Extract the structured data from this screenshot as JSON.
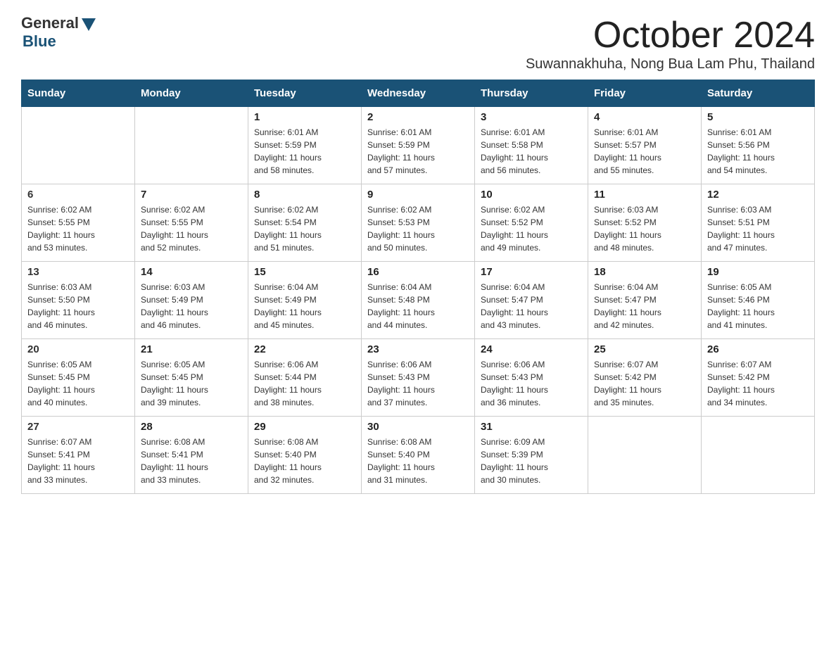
{
  "logo": {
    "general": "General",
    "blue": "Blue"
  },
  "title": "October 2024",
  "location": "Suwannakhuha, Nong Bua Lam Phu, Thailand",
  "days_of_week": [
    "Sunday",
    "Monday",
    "Tuesday",
    "Wednesday",
    "Thursday",
    "Friday",
    "Saturday"
  ],
  "weeks": [
    [
      {
        "day": "",
        "info": ""
      },
      {
        "day": "",
        "info": ""
      },
      {
        "day": "1",
        "info": "Sunrise: 6:01 AM\nSunset: 5:59 PM\nDaylight: 11 hours\nand 58 minutes."
      },
      {
        "day": "2",
        "info": "Sunrise: 6:01 AM\nSunset: 5:59 PM\nDaylight: 11 hours\nand 57 minutes."
      },
      {
        "day": "3",
        "info": "Sunrise: 6:01 AM\nSunset: 5:58 PM\nDaylight: 11 hours\nand 56 minutes."
      },
      {
        "day": "4",
        "info": "Sunrise: 6:01 AM\nSunset: 5:57 PM\nDaylight: 11 hours\nand 55 minutes."
      },
      {
        "day": "5",
        "info": "Sunrise: 6:01 AM\nSunset: 5:56 PM\nDaylight: 11 hours\nand 54 minutes."
      }
    ],
    [
      {
        "day": "6",
        "info": "Sunrise: 6:02 AM\nSunset: 5:55 PM\nDaylight: 11 hours\nand 53 minutes."
      },
      {
        "day": "7",
        "info": "Sunrise: 6:02 AM\nSunset: 5:55 PM\nDaylight: 11 hours\nand 52 minutes."
      },
      {
        "day": "8",
        "info": "Sunrise: 6:02 AM\nSunset: 5:54 PM\nDaylight: 11 hours\nand 51 minutes."
      },
      {
        "day": "9",
        "info": "Sunrise: 6:02 AM\nSunset: 5:53 PM\nDaylight: 11 hours\nand 50 minutes."
      },
      {
        "day": "10",
        "info": "Sunrise: 6:02 AM\nSunset: 5:52 PM\nDaylight: 11 hours\nand 49 minutes."
      },
      {
        "day": "11",
        "info": "Sunrise: 6:03 AM\nSunset: 5:52 PM\nDaylight: 11 hours\nand 48 minutes."
      },
      {
        "day": "12",
        "info": "Sunrise: 6:03 AM\nSunset: 5:51 PM\nDaylight: 11 hours\nand 47 minutes."
      }
    ],
    [
      {
        "day": "13",
        "info": "Sunrise: 6:03 AM\nSunset: 5:50 PM\nDaylight: 11 hours\nand 46 minutes."
      },
      {
        "day": "14",
        "info": "Sunrise: 6:03 AM\nSunset: 5:49 PM\nDaylight: 11 hours\nand 46 minutes."
      },
      {
        "day": "15",
        "info": "Sunrise: 6:04 AM\nSunset: 5:49 PM\nDaylight: 11 hours\nand 45 minutes."
      },
      {
        "day": "16",
        "info": "Sunrise: 6:04 AM\nSunset: 5:48 PM\nDaylight: 11 hours\nand 44 minutes."
      },
      {
        "day": "17",
        "info": "Sunrise: 6:04 AM\nSunset: 5:47 PM\nDaylight: 11 hours\nand 43 minutes."
      },
      {
        "day": "18",
        "info": "Sunrise: 6:04 AM\nSunset: 5:47 PM\nDaylight: 11 hours\nand 42 minutes."
      },
      {
        "day": "19",
        "info": "Sunrise: 6:05 AM\nSunset: 5:46 PM\nDaylight: 11 hours\nand 41 minutes."
      }
    ],
    [
      {
        "day": "20",
        "info": "Sunrise: 6:05 AM\nSunset: 5:45 PM\nDaylight: 11 hours\nand 40 minutes."
      },
      {
        "day": "21",
        "info": "Sunrise: 6:05 AM\nSunset: 5:45 PM\nDaylight: 11 hours\nand 39 minutes."
      },
      {
        "day": "22",
        "info": "Sunrise: 6:06 AM\nSunset: 5:44 PM\nDaylight: 11 hours\nand 38 minutes."
      },
      {
        "day": "23",
        "info": "Sunrise: 6:06 AM\nSunset: 5:43 PM\nDaylight: 11 hours\nand 37 minutes."
      },
      {
        "day": "24",
        "info": "Sunrise: 6:06 AM\nSunset: 5:43 PM\nDaylight: 11 hours\nand 36 minutes."
      },
      {
        "day": "25",
        "info": "Sunrise: 6:07 AM\nSunset: 5:42 PM\nDaylight: 11 hours\nand 35 minutes."
      },
      {
        "day": "26",
        "info": "Sunrise: 6:07 AM\nSunset: 5:42 PM\nDaylight: 11 hours\nand 34 minutes."
      }
    ],
    [
      {
        "day": "27",
        "info": "Sunrise: 6:07 AM\nSunset: 5:41 PM\nDaylight: 11 hours\nand 33 minutes."
      },
      {
        "day": "28",
        "info": "Sunrise: 6:08 AM\nSunset: 5:41 PM\nDaylight: 11 hours\nand 33 minutes."
      },
      {
        "day": "29",
        "info": "Sunrise: 6:08 AM\nSunset: 5:40 PM\nDaylight: 11 hours\nand 32 minutes."
      },
      {
        "day": "30",
        "info": "Sunrise: 6:08 AM\nSunset: 5:40 PM\nDaylight: 11 hours\nand 31 minutes."
      },
      {
        "day": "31",
        "info": "Sunrise: 6:09 AM\nSunset: 5:39 PM\nDaylight: 11 hours\nand 30 minutes."
      },
      {
        "day": "",
        "info": ""
      },
      {
        "day": "",
        "info": ""
      }
    ]
  ]
}
